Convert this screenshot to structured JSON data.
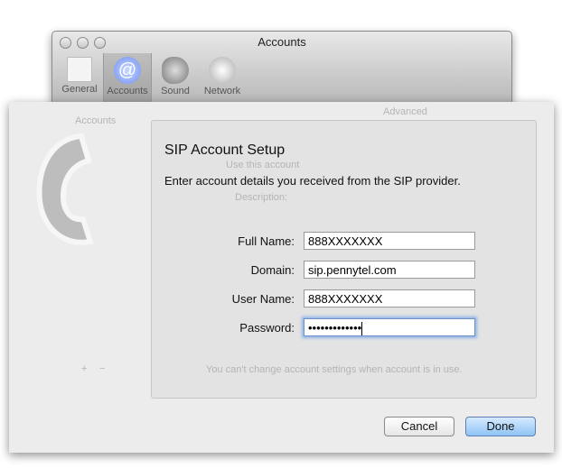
{
  "window": {
    "title": "Accounts",
    "toolbar": [
      {
        "label": "General",
        "icon": "switch-icon"
      },
      {
        "label": "Accounts",
        "icon": "at-icon",
        "selected": true
      },
      {
        "label": "Sound",
        "icon": "speaker-icon"
      },
      {
        "label": "Network",
        "icon": "globe-icon"
      }
    ]
  },
  "background": {
    "accounts_header": "Accounts",
    "advanced_tab": "Advanced",
    "use_account": "Use this account",
    "description_label": "Description:",
    "notice": "You can't change account settings when account is in use.",
    "add": "+",
    "remove": "−"
  },
  "sheet": {
    "title": "SIP Account Setup",
    "description": "Enter account details you received from the SIP provider.",
    "fields": [
      {
        "label": "Full Name:",
        "value": "888XXXXXXX"
      },
      {
        "label": "Domain:",
        "value": "sip.pennytel.com"
      },
      {
        "label": "User Name:",
        "value": "888XXXXXXX"
      },
      {
        "label": "Password:",
        "value": "•••••••••••••"
      }
    ],
    "cancel": "Cancel",
    "done": "Done"
  }
}
